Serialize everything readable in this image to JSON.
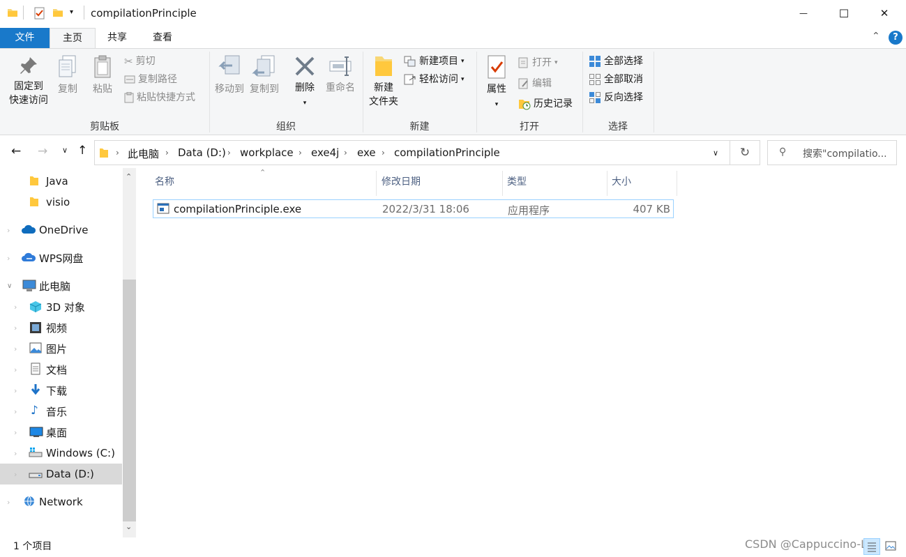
{
  "window": {
    "title": "compilationPrinciple",
    "minimize_glyph": "—",
    "maximize_glyph": "☐",
    "close_glyph": "✕"
  },
  "tabs": {
    "file": "文件",
    "home": "主页",
    "share": "共享",
    "view": "查看"
  },
  "ribbon": {
    "clipboard": {
      "label": "剪贴板",
      "pin_line1": "固定到",
      "pin_line2": "快速访问",
      "copy": "复制",
      "paste": "粘贴",
      "cut": "剪切",
      "copy_path": "复制路径",
      "paste_shortcut": "粘贴快捷方式"
    },
    "organize": {
      "label": "组织",
      "move_to": "移动到",
      "copy_to": "复制到",
      "delete": "删除",
      "rename": "重命名"
    },
    "new": {
      "label": "新建",
      "new_folder_line1": "新建",
      "new_folder_line2": "文件夹",
      "new_item": "新建项目",
      "easy_access": "轻松访问"
    },
    "open": {
      "label": "打开",
      "properties": "属性",
      "open": "打开",
      "edit": "编辑",
      "history": "历史记录"
    },
    "select": {
      "label": "选择",
      "select_all": "全部选择",
      "select_none": "全部取消",
      "invert": "反向选择"
    }
  },
  "address": {
    "crumbs": [
      "此电脑",
      "Data (D:)",
      "workplace",
      "exe4j",
      "exe",
      "compilationPrinciple"
    ],
    "search_placeholder": "搜索\"compilatio..."
  },
  "nav": {
    "items": [
      {
        "label": "Java",
        "icon": "folder-icon"
      },
      {
        "label": "visio",
        "icon": "folder-icon"
      },
      {
        "label": "OneDrive",
        "icon": "cloud-icon"
      },
      {
        "label": "WPS网盘",
        "icon": "cloud-icon"
      },
      {
        "label": "此电脑",
        "icon": "computer-icon"
      },
      {
        "label": "3D 对象",
        "icon": "cube-icon"
      },
      {
        "label": "视频",
        "icon": "film-icon"
      },
      {
        "label": "图片",
        "icon": "picture-icon"
      },
      {
        "label": "文档",
        "icon": "document-icon"
      },
      {
        "label": "下载",
        "icon": "download-icon"
      },
      {
        "label": "音乐",
        "icon": "music-icon"
      },
      {
        "label": "桌面",
        "icon": "desktop-icon"
      },
      {
        "label": "Windows (C:)",
        "icon": "drive-icon"
      },
      {
        "label": "Data (D:)",
        "icon": "drive-icon"
      },
      {
        "label": "Network",
        "icon": "network-icon"
      }
    ]
  },
  "list": {
    "columns": {
      "name": "名称",
      "modified": "修改日期",
      "type": "类型",
      "size": "大小"
    },
    "rows": [
      {
        "name": "compilationPrinciple.exe",
        "modified": "2022/3/31 18:06",
        "type": "应用程序",
        "size": "407 KB"
      }
    ]
  },
  "status": {
    "item_count": "1 个项目",
    "watermark": "CSDN @Cappuccino-Luo"
  },
  "colors": {
    "file_tab": "#1979ca",
    "ribbon_bg": "#f5f6f7",
    "selection_border": "#99d1ff",
    "nav_selected": "#d9d9d9"
  }
}
